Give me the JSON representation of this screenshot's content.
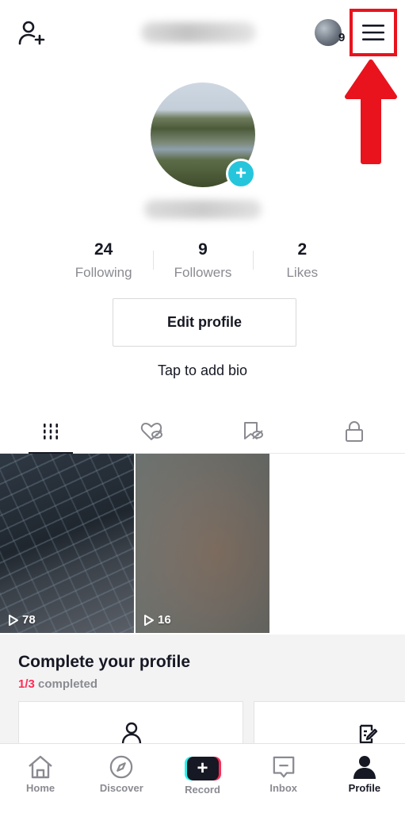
{
  "header": {
    "story_count": "9"
  },
  "profile": {
    "avatar_add_symbol": "+"
  },
  "stats": [
    {
      "value": "24",
      "label": "Following"
    },
    {
      "value": "9",
      "label": "Followers"
    },
    {
      "value": "2",
      "label": "Likes"
    }
  ],
  "edit_profile_label": "Edit profile",
  "bio_prompt": "Tap to add bio",
  "tabs": [
    {
      "icon": "grid-icon",
      "active": true
    },
    {
      "icon": "liked-hidden-icon",
      "active": false
    },
    {
      "icon": "saved-hidden-icon",
      "active": false
    },
    {
      "icon": "lock-icon",
      "active": false
    }
  ],
  "videos": [
    {
      "views": "78"
    },
    {
      "views": "16"
    }
  ],
  "complete_profile": {
    "title": "Complete your profile",
    "progress_done": "1/3",
    "progress_suffix": "completed"
  },
  "nav": {
    "home": "Home",
    "discover": "Discover",
    "record": "Record",
    "record_symbol": "+",
    "inbox": "Inbox",
    "profile": "Profile"
  },
  "colors": {
    "accent_red": "#fe2c55",
    "accent_cyan": "#25f4ee",
    "annotation_red": "#e8131d",
    "avatar_badge": "#25c6dc"
  }
}
